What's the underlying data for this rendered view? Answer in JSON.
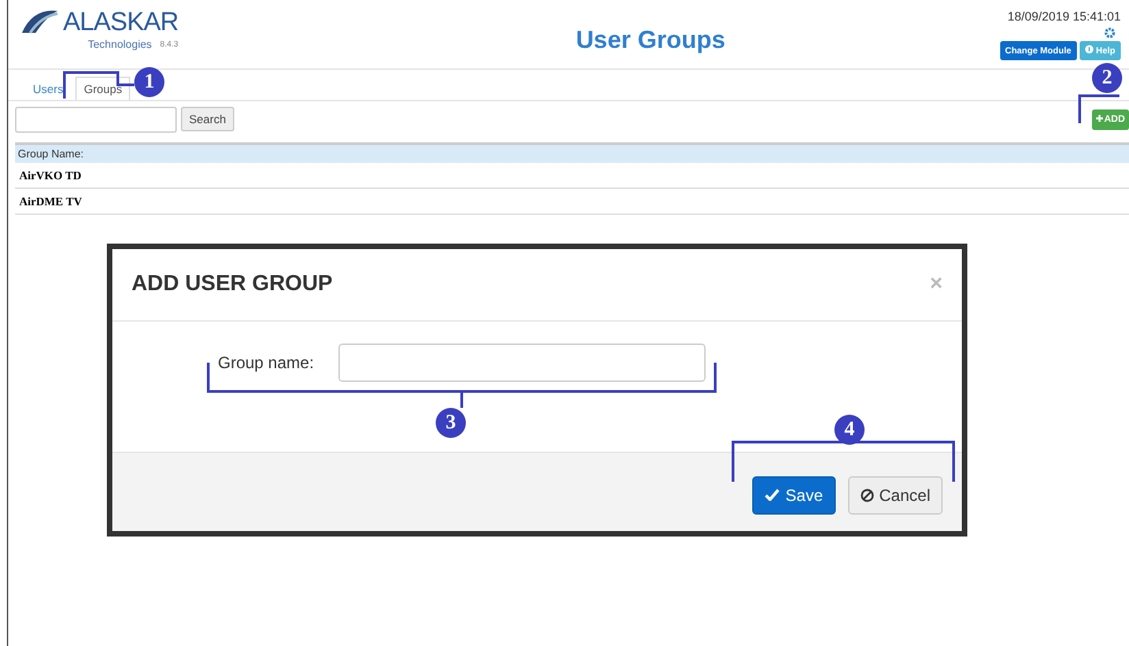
{
  "header": {
    "logo": "ALASKAR",
    "logo_sub": "Technologies",
    "version": "8.4.3",
    "title": "User Groups",
    "datetime": "18/09/2019 15:41:01",
    "buttons": [
      {
        "label": "Change Module",
        "kind": "primary"
      },
      {
        "label": "Help",
        "kind": "info"
      }
    ]
  },
  "tabs": [
    {
      "label": "Users",
      "selected": false
    },
    {
      "label": "Groups",
      "selected": true
    }
  ],
  "search": {
    "button": "Search"
  },
  "add_button": "ADD",
  "table": {
    "columns": [
      "Group Name:"
    ],
    "rows": [
      [
        "AirVKO TD"
      ],
      [
        "AirDME TV"
      ]
    ]
  },
  "dialog": {
    "title": "ADD USER GROUP",
    "close": "×",
    "field_label": "Group name:",
    "save": "Save",
    "cancel": "Cancel"
  },
  "callouts": [
    {
      "label": "1"
    },
    {
      "label": "2"
    },
    {
      "label": "3"
    },
    {
      "label": "4"
    }
  ]
}
